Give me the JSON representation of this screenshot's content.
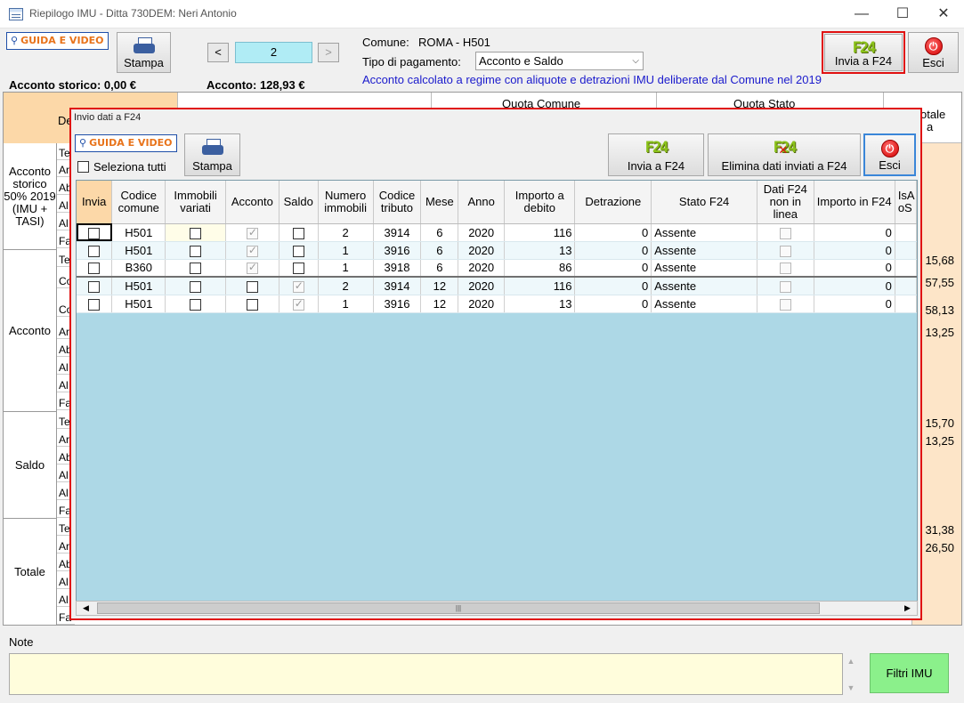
{
  "window": {
    "title": "Riepilogo IMU - Ditta 730DEM: Neri Antonio",
    "minimize": "—",
    "maximize": "☐",
    "close": "✕"
  },
  "toolbar": {
    "guida_label": "GUIDA E VIDEO",
    "stampa_label": "Stampa",
    "prev_label": "<",
    "next_label": ">",
    "page_value": "2",
    "comune_label": "Comune:",
    "comune_value": "ROMA - H501",
    "tipo_label": "Tipo di pagamento:",
    "tipo_value": "Acconto e Saldo",
    "info_text": "Acconto calcolato a regime con aliquote e detrazioni IMU deliberate dal Comune nel 2019",
    "invia_f24_label": "Invia a F24",
    "esci_label": "Esci",
    "acconto_storico": "Acconto storico: 0,00 €",
    "acconto": "Acconto: 128,93 €"
  },
  "background": {
    "head_de": "De",
    "quota_comune": "Quota Comune",
    "quota_stato": "Quota Stato",
    "totale_head": "otale",
    "totale_head2": "a",
    "groups": [
      {
        "label": "Acconto storico 50% 2019 (IMU + TASI)",
        "subs": [
          "Te",
          "Ar",
          "Ab",
          "Al",
          "Al",
          "Fa"
        ]
      },
      {
        "label": "Acconto",
        "subs": [
          "Te",
          "Co",
          "",
          "Co",
          "",
          "Ar",
          "Ab",
          "Al",
          "Al",
          "Fa"
        ]
      },
      {
        "label": "Saldo",
        "subs": [
          "Te",
          "Ar",
          "Ab",
          "Al",
          "Al",
          "Fa"
        ]
      },
      {
        "label": "Totale",
        "subs": [
          "Te",
          "Ar",
          "Ab",
          "Al",
          "Al",
          "Fa"
        ]
      }
    ],
    "right_values": [
      "15,68",
      "57,55",
      "58,13",
      "13,25",
      "15,70",
      "13,25",
      "31,38",
      "26,50"
    ]
  },
  "dialog": {
    "title": "Invio dati a F24",
    "guida_label": "GUIDA E VIDEO",
    "seleziona_tutti": "Seleziona tutti",
    "stampa_label": "Stampa",
    "invia_f24_label": "Invia a F24",
    "elimina_label": "Elimina dati inviati a F24",
    "esci_label": "Esci",
    "columns": [
      "Invia",
      "Codice comune",
      "Immobili variati",
      "Acconto",
      "Saldo",
      "Numero immobili",
      "Codice tributo",
      "Mese",
      "Anno",
      "Importo a debito",
      "Detrazione",
      "Stato F24",
      "Dati F24 non in linea",
      "Importo in F24",
      "IsA oS"
    ],
    "rows": [
      {
        "codice": "H501",
        "acconto": true,
        "saldo": false,
        "numero": "2",
        "tributo": "3914",
        "mese": "6",
        "anno": "2020",
        "importo": "116",
        "detrazione": "0",
        "stato": "Assente",
        "importo_f24": "0"
      },
      {
        "codice": "H501",
        "acconto": true,
        "saldo": false,
        "numero": "1",
        "tributo": "3916",
        "mese": "6",
        "anno": "2020",
        "importo": "13",
        "detrazione": "0",
        "stato": "Assente",
        "importo_f24": "0"
      },
      {
        "codice": "B360",
        "acconto": true,
        "saldo": false,
        "numero": "1",
        "tributo": "3918",
        "mese": "6",
        "anno": "2020",
        "importo": "86",
        "detrazione": "0",
        "stato": "Assente",
        "importo_f24": "0"
      },
      {
        "codice": "H501",
        "acconto": false,
        "saldo": true,
        "numero": "2",
        "tributo": "3914",
        "mese": "12",
        "anno": "2020",
        "importo": "116",
        "detrazione": "0",
        "stato": "Assente",
        "importo_f24": "0"
      },
      {
        "codice": "H501",
        "acconto": false,
        "saldo": true,
        "numero": "1",
        "tributo": "3916",
        "mese": "12",
        "anno": "2020",
        "importo": "13",
        "detrazione": "0",
        "stato": "Assente",
        "importo_f24": "0"
      }
    ]
  },
  "notes": {
    "label": "Note",
    "value": "",
    "filtri_label": "Filtri IMU"
  },
  "colors": {
    "accent_frame": "#e01010",
    "grid_background": "#add8e6",
    "filtri_button": "#8bf08b",
    "info_text": "#1a1acc",
    "totale_column": "#fde5c8",
    "f24_icon": "#8bc21b"
  }
}
